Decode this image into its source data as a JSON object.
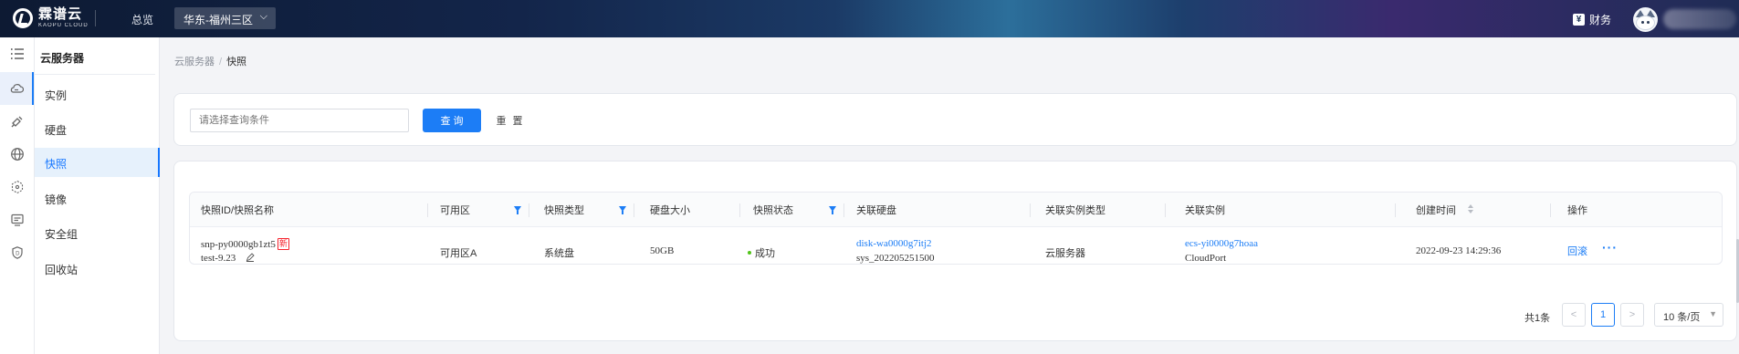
{
  "topbar": {
    "logo_cn": "霖谱云",
    "logo_en": "KAOPU CLOUD",
    "overview": "总览",
    "region": "华东-福州三区",
    "finance": "财务",
    "yen": "¥"
  },
  "rail": {
    "icons": [
      "menu-icon",
      "cloud-host-icon",
      "disk-icon",
      "network-icon",
      "mirror-icon",
      "monitor-icon",
      "shield-icon"
    ]
  },
  "subnav": {
    "title": "云服务器",
    "items": [
      {
        "label": "实例"
      },
      {
        "label": "硬盘"
      },
      {
        "label": "快照",
        "active": true
      },
      {
        "label": "镜像"
      },
      {
        "label": "安全组"
      },
      {
        "label": "回收站"
      }
    ]
  },
  "breadcrumb": {
    "parent": "云服务器",
    "separator": "/",
    "current": "快照"
  },
  "search": {
    "placeholder": "请选择查询条件",
    "query_label": "查 询",
    "reset_label": "重 置"
  },
  "table": {
    "columns": [
      "快照ID/快照名称",
      "可用区",
      "快照类型",
      "硬盘大小",
      "快照状态",
      "关联硬盘",
      "关联实例类型",
      "关联实例",
      "创建时间",
      "操作"
    ],
    "rows": [
      {
        "snapshot_id": "snp-py0000gb1zt5",
        "new_badge": "新",
        "snapshot_name": "test-9.23",
        "zone": "可用区A",
        "type": "系统盘",
        "size": "50GB",
        "status": "成功",
        "disk_id": "disk-wa0000g7itj2",
        "disk_name": "sys_202205251500",
        "instance_type": "云服务器",
        "instance_id": "ecs-yi0000g7hoaa",
        "instance_name": "CloudPort",
        "created": "2022-09-23 14:29:36",
        "action_rollback": "回滚",
        "action_more": "···"
      }
    ]
  },
  "pagination": {
    "total": "共1条",
    "prev": "<",
    "current": "1",
    "next": ">",
    "page_size": "10 条/页"
  },
  "colors": {
    "primary": "#1c7df6",
    "success": "#52c41a",
    "danger": "#f5222d"
  }
}
